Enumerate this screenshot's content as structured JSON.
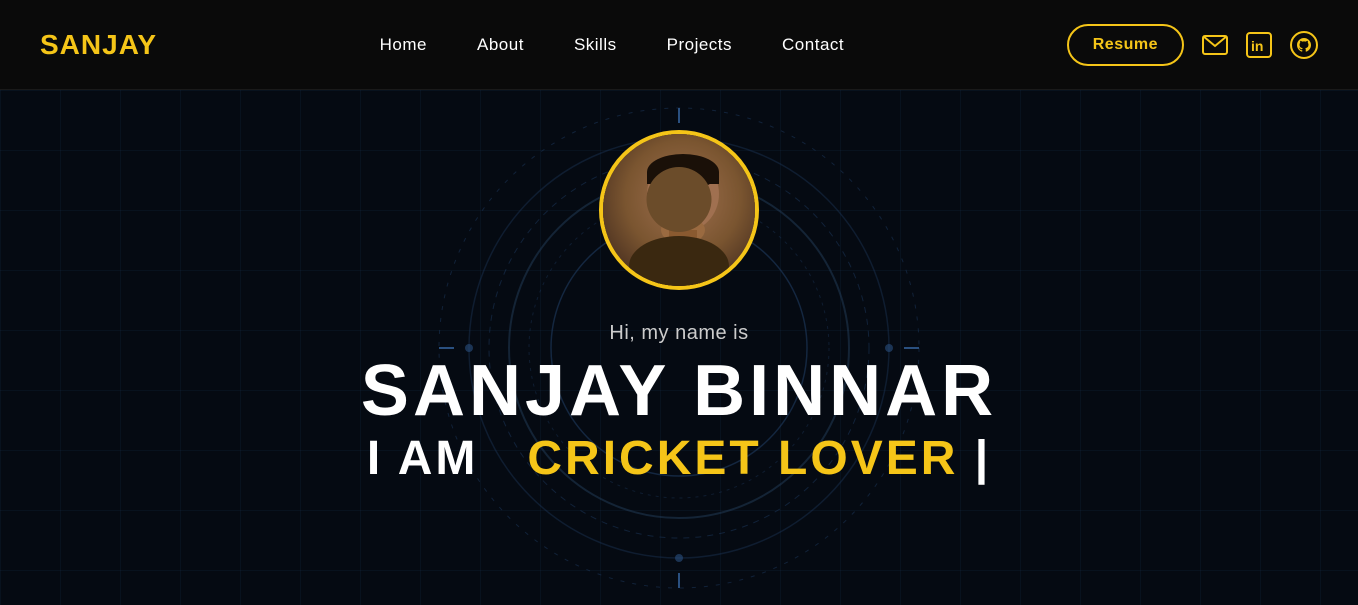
{
  "logo": {
    "prefix": "SAN",
    "suffix": "JAY"
  },
  "navbar": {
    "links": [
      {
        "id": "home",
        "label": "Home"
      },
      {
        "id": "about",
        "label": "About"
      },
      {
        "id": "skills",
        "label": "Skills"
      },
      {
        "id": "projects",
        "label": "Projects"
      },
      {
        "id": "contact",
        "label": "Contact"
      }
    ],
    "resume_label": "Resume",
    "email_icon": "✉",
    "linkedin_icon": "in",
    "github_icon": "⊛"
  },
  "hero": {
    "greeting": "Hi, my name is",
    "name": "SANJAY BINNAR",
    "tagline_prefix": "I AM",
    "tagline_highlight": "CRICKET LOVER"
  },
  "colors": {
    "accent": "#f5c518",
    "bg": "#050a12",
    "nav_bg": "#0a0a0a",
    "text_primary": "#ffffff",
    "text_secondary": "#cccccc"
  }
}
